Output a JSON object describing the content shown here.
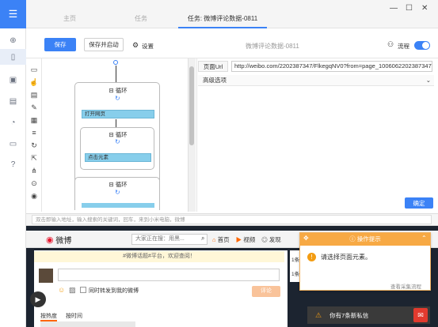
{
  "tabs": [
    "主页",
    "任务",
    "任务: 微博评论数据-0811"
  ],
  "window_controls": [
    "—",
    "☐",
    "✕"
  ],
  "toolbar": {
    "save_label": "保存",
    "save_start_label": "保存并启动",
    "settings_label": "设置",
    "task_name": "微博评论数据-0811",
    "flow_label": "流程"
  },
  "sidebar_icons": [
    "menu-icon",
    "add-icon",
    "document-icon",
    "box-icon",
    "page-icon",
    "clock-icon",
    "message-icon",
    "help-icon"
  ],
  "flow": {
    "loop1_label": "循环",
    "node1_label": "打开网页",
    "loop2_label": "循环",
    "node2_label": "点击元素",
    "loop3_label": "循环"
  },
  "props": {
    "url_label": "页面Url",
    "url_value": "http://weibo.com/2202387347/FlkegqNV0?from=page_1006062202387347",
    "advanced_label": "高级选项",
    "confirm_label": "确定"
  },
  "browser": {
    "address_placeholder": "双击即输入地址，输入搜索的关键词，回车，来到小米电脑，微博"
  },
  "weibo": {
    "logo_text": "微博",
    "search_placeholder": "大家正在搜：用黑...",
    "nav_home": "首页",
    "nav_video": "视频",
    "nav_discover": "发现",
    "notice": "#微博话题#平台，欢迎查阅！",
    "checkbox_label": "同时转发到我的微博",
    "publish_label": "评论",
    "tab_hot": "按热度",
    "tab_time": "按时间",
    "right_col_1": "1条",
    "right_col_2": "1条",
    "msg_text": "你有7条新私信"
  },
  "tip": {
    "title": "操作提示",
    "body": "请选择页面元素。",
    "link": "查看采集流程"
  }
}
